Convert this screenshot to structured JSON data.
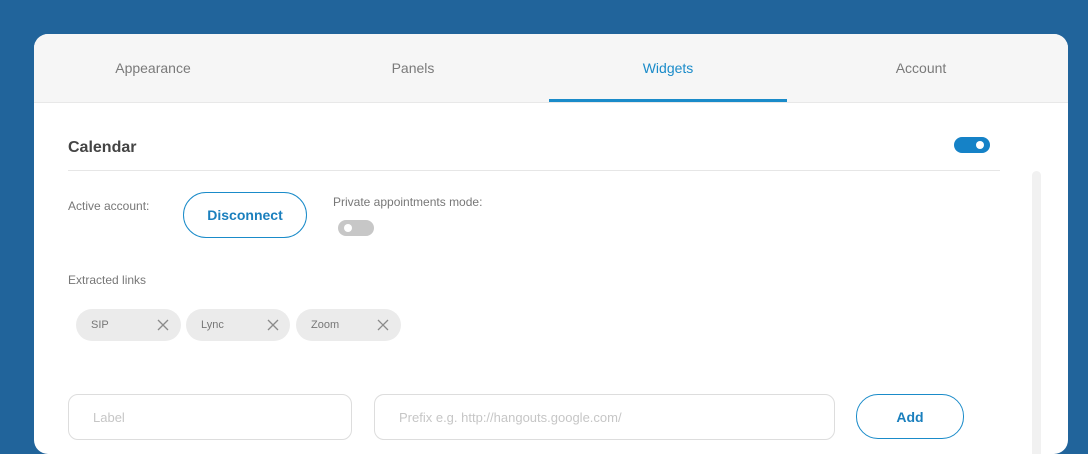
{
  "tabs": [
    {
      "label": "Appearance",
      "active": false
    },
    {
      "label": "Panels",
      "active": false
    },
    {
      "label": "Widgets",
      "active": true
    },
    {
      "label": "Account",
      "active": false
    }
  ],
  "calendar": {
    "title": "Calendar",
    "enabled": true,
    "active_account_label": "Active account:",
    "disconnect_label": "Disconnect",
    "private_mode_label": "Private appointments mode:",
    "private_mode_enabled": false,
    "extracted_links_label": "Extracted links",
    "links": [
      {
        "label": "SIP",
        "remove_icon": "close-icon"
      },
      {
        "label": "Lync",
        "remove_icon": "close-icon"
      },
      {
        "label": "Zoom",
        "remove_icon": "close-icon"
      }
    ],
    "new_link": {
      "label_placeholder": "Label",
      "label_value": "",
      "prefix_placeholder": "Prefix e.g. http://hangouts.google.com/",
      "prefix_value": "",
      "add_label": "Add"
    }
  },
  "colors": {
    "background": "#21649b",
    "accent": "#1a8bc9",
    "toggle_on": "#1582c7",
    "toggle_off": "#c7c7c7",
    "chip_bg": "#ebebeb"
  }
}
